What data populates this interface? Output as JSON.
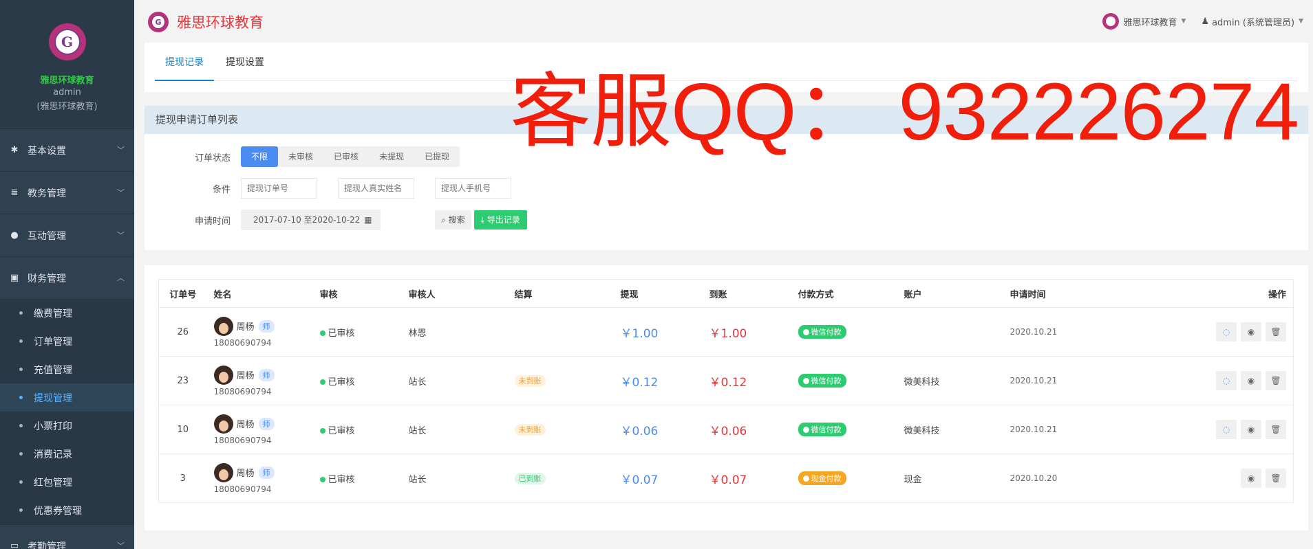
{
  "sidebar": {
    "org": "雅思环球教育",
    "user": "admin",
    "user_org": "(雅思环球教育)",
    "groups": [
      {
        "label": "基本设置",
        "icon": "gear-icon"
      },
      {
        "label": "教务管理",
        "icon": "database-icon"
      },
      {
        "label": "互动管理",
        "icon": "chat-icon"
      },
      {
        "label": "财务管理",
        "icon": "money-icon"
      },
      {
        "label": "考勤管理",
        "icon": "card-icon"
      }
    ],
    "finance_items": [
      "缴费管理",
      "订单管理",
      "充值管理",
      "提现管理",
      "小票打印",
      "消费记录",
      "红包管理",
      "优惠券管理"
    ],
    "active_item": "提现管理"
  },
  "topbar": {
    "brand": "雅思环球教育",
    "org_menu": "雅思环球教育",
    "user_menu": "admin (系统管理员)"
  },
  "tabs": [
    "提现记录",
    "提现设置"
  ],
  "filter": {
    "title": "提现申请订单列表",
    "status_label": "订单状态",
    "statuses": [
      "不限",
      "未审核",
      "已审核",
      "未提现",
      "已提现"
    ],
    "condition_label": "条件",
    "placeholders": [
      "提现订单号",
      "提现人真实姓名",
      "提现人手机号"
    ],
    "date_label": "申请时间",
    "date_range": "2017-07-10 至2020-10-22",
    "search_btn": "搜索",
    "export_btn": "导出记录"
  },
  "watermark": "客服QQ： 932226274",
  "table": {
    "headers": [
      "订单号",
      "姓名",
      "审核",
      "审核人",
      "结算",
      "提现",
      "到账",
      "付款方式",
      "账户",
      "申请时间",
      "操作"
    ],
    "rows": [
      {
        "id": "26",
        "name": "周杨",
        "role": "师",
        "phone": "18080690794",
        "review": "已审核",
        "reviewer": "林恩",
        "settle": "",
        "withdraw": "￥1.00",
        "received": "￥1.00",
        "pay": "微信付款",
        "account": "",
        "date": "2020.10.21"
      },
      {
        "id": "23",
        "name": "周杨",
        "role": "师",
        "phone": "18080690794",
        "review": "已审核",
        "reviewer": "站长",
        "settle": "未到账",
        "withdraw": "￥0.12",
        "received": "￥0.12",
        "pay": "微信付款",
        "account": "微美科技",
        "date": "2020.10.21"
      },
      {
        "id": "10",
        "name": "周杨",
        "role": "师",
        "phone": "18080690794",
        "review": "已审核",
        "reviewer": "站长",
        "settle": "未到账",
        "withdraw": "￥0.06",
        "received": "￥0.06",
        "pay": "微信付款",
        "account": "微美科技",
        "date": "2020.10.21"
      },
      {
        "id": "3",
        "name": "周杨",
        "role": "师",
        "phone": "18080690794",
        "review": "已审核",
        "reviewer": "站长",
        "settle": "已到账",
        "withdraw": "￥0.07",
        "received": "￥0.07",
        "pay": "现金付款",
        "account": "现金",
        "date": "2020.10.20"
      }
    ]
  }
}
